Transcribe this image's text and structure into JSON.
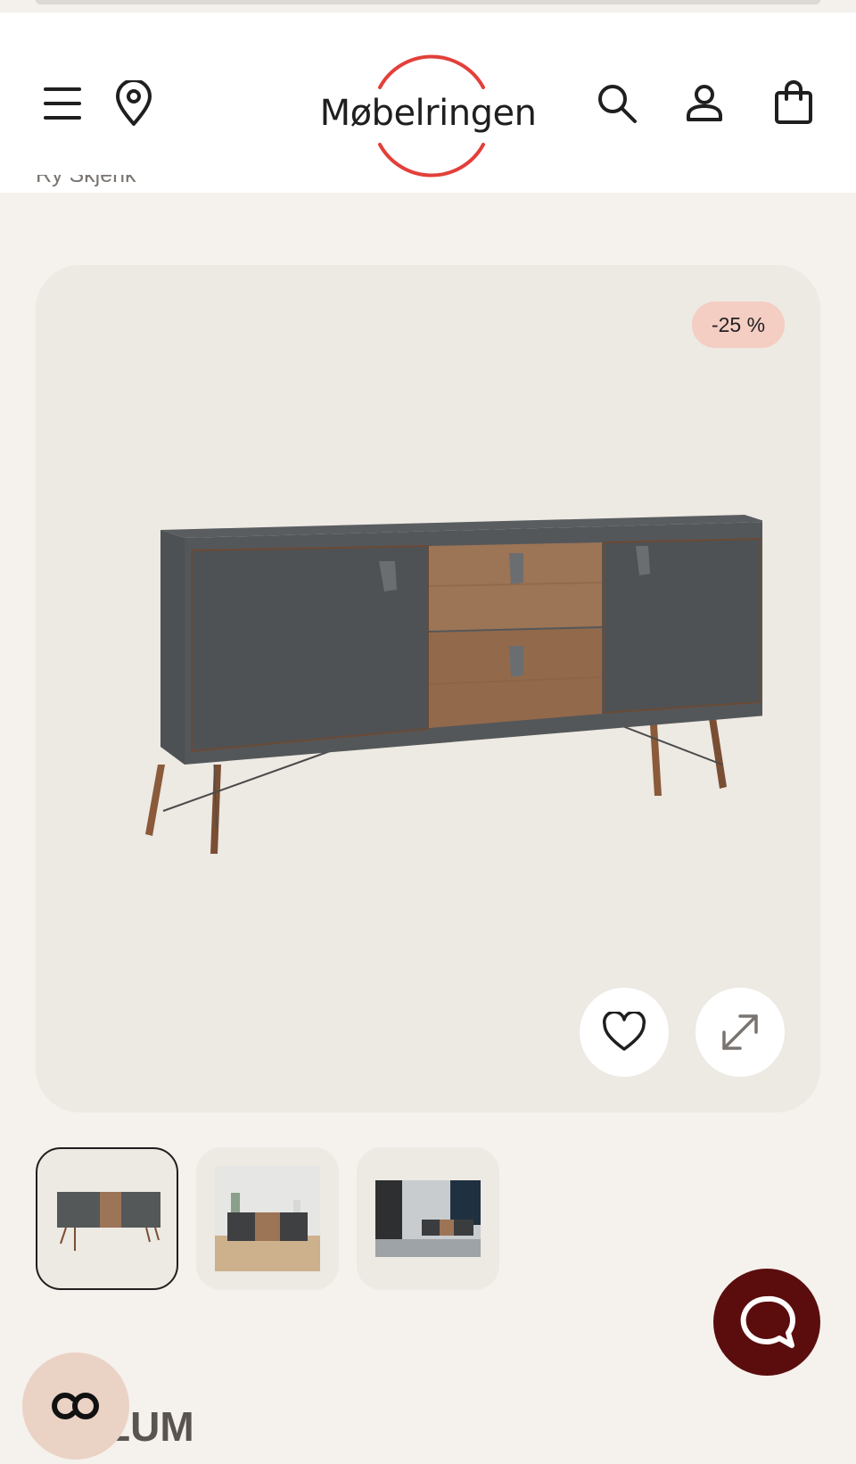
{
  "header": {
    "logo_text": "Møbelringen",
    "icons": [
      "menu-icon",
      "location-pin-icon",
      "search-icon",
      "user-icon",
      "shopping-bag-icon"
    ]
  },
  "breadcrumb": {
    "text": "Ry Skjenk"
  },
  "product": {
    "discount_badge": "-25 %",
    "image_alt": "Ry Skjenk sideboard",
    "thumbnails": [
      "thumb-1",
      "thumb-2",
      "thumb-3"
    ],
    "selected_thumbnail": 0
  },
  "partial_title": "LUM",
  "colors": {
    "brand_red": "#e2403b",
    "badge_bg": "#f4cdc3",
    "chat_bg": "#5b0d0d",
    "co_bg": "#ead2c5",
    "page_bg": "#f5f1ed",
    "card_bg": "#ede9e3"
  }
}
